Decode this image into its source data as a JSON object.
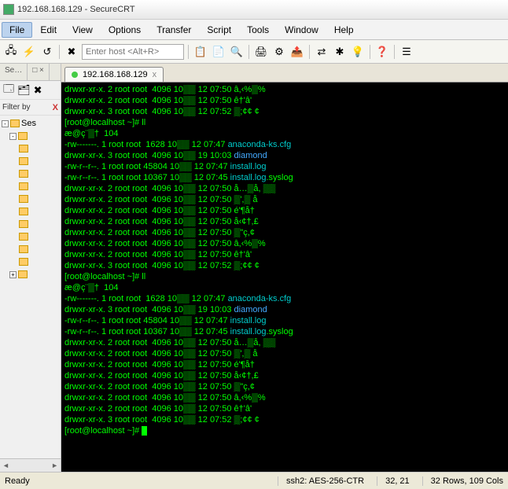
{
  "window": {
    "title": "192.168.168.129 - SecureCRT"
  },
  "menu": {
    "file": "File",
    "edit": "Edit",
    "view": "View",
    "options": "Options",
    "transfer": "Transfer",
    "script": "Script",
    "tools": "Tools",
    "window": "Window",
    "help": "Help"
  },
  "toolbar": {
    "host_placeholder": "Enter host <Alt+R>"
  },
  "sidebar": {
    "tab1": "Se…",
    "tab2": "□ ×",
    "filter_label": "Filter by",
    "filter_x": "X",
    "tree_root": "Ses"
  },
  "tab": {
    "label": "192.168.168.129",
    "close": "x"
  },
  "terminal": {
    "lines": [
      "drwxr-xr-x. 2 root root  4096 10▒▒ 12 07:50 â,‹%▒%",
      "drwxr-xr-x. 2 root root  4096 10▒▒ 12 07:50 ê†'â'",
      "drwxr-xr-x. 3 root root  4096 10▒▒ 12 07:52 ▒;¢¢ ¢",
      "[root@localhost ~]# ll",
      "æ@ç¨▒†  104",
      "-rw-------. 1 root root  1628 10▒▒ 12 07:47 anaconda-ks.cfg",
      "drwxr-xr-x. 3 root root  4096 10▒▒ 19 10:03 diamond",
      "-rw-r--r--. 1 root root 45804 10▒▒ 12 07:47 install.log",
      "-rw-r--r--. 1 root root 10367 10▒▒ 12 07:45 install.log.syslog",
      "drwxr-xr-x. 2 root root  4096 10▒▒ 12 07:50 å…▒å, ▒▒",
      "drwxr-xr-x. 2 root root  4096 10▒▒ 12 07:50 ▒',▒ å",
      "drwxr-xr-x. 2 root root  4096 10▒▒ 12 07:50 é'¶å†",
      "drwxr-xr-x. 2 root root  4096 10▒▒ 12 07:50 å‹¢†,£",
      "drwxr-xr-x. 2 root root  4096 10▒▒ 12 07:50 ▒\"ç,¢",
      "drwxr-xr-x. 2 root root  4096 10▒▒ 12 07:50 â,‹%▒%",
      "drwxr-xr-x. 2 root root  4096 10▒▒ 12 07:50 ê†'â'",
      "drwxr-xr-x. 3 root root  4096 10▒▒ 12 07:52 ▒;¢¢ ¢",
      "[root@localhost ~]# ll",
      "æ@ç¨▒†  104",
      "-rw-------. 1 root root  1628 10▒▒ 12 07:47 anaconda-ks.cfg",
      "drwxr-xr-x. 3 root root  4096 10▒▒ 19 10:03 diamond",
      "-rw-r--r--. 1 root root 45804 10▒▒ 12 07:47 install.log",
      "-rw-r--r--. 1 root root 10367 10▒▒ 12 07:45 install.log.syslog",
      "drwxr-xr-x. 2 root root  4096 10▒▒ 12 07:50 å…▒å, ▒▒",
      "drwxr-xr-x. 2 root root  4096 10▒▒ 12 07:50 ▒',▒ å",
      "drwxr-xr-x. 2 root root  4096 10▒▒ 12 07:50 é'¶å†",
      "drwxr-xr-x. 2 root root  4096 10▒▒ 12 07:50 å‹¢†,£",
      "drwxr-xr-x. 2 root root  4096 10▒▒ 12 07:50 ▒\"ç,¢",
      "drwxr-xr-x. 2 root root  4096 10▒▒ 12 07:50 â,‹%▒%",
      "drwxr-xr-x. 2 root root  4096 10▒▒ 12 07:50 ê†'â'",
      "drwxr-xr-x. 3 root root  4096 10▒▒ 12 07:52 ▒;¢¢ ¢",
      "[root@localhost ~]# "
    ]
  },
  "status": {
    "ready": "Ready",
    "cipher": "ssh2: AES-256-CTR",
    "cursor": "32,  21",
    "size": "32 Rows, 109 Cols"
  }
}
